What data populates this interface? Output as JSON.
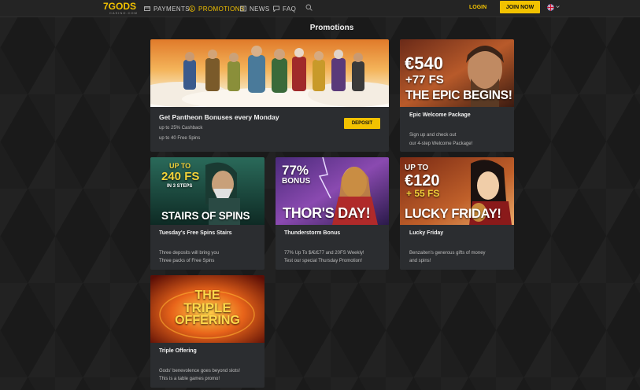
{
  "logo": {
    "main": "7GODS",
    "sub": "CASINO.COM"
  },
  "nav": [
    {
      "label": "PAYMENTS",
      "icon": "payments-icon"
    },
    {
      "label": "PROMOTIONS",
      "icon": "promotions-icon",
      "active": true
    },
    {
      "label": "NEWS",
      "icon": "news-icon"
    },
    {
      "label": "FAQ",
      "icon": "faq-icon"
    }
  ],
  "header": {
    "login": "LOGIN",
    "join": "JOIN NOW",
    "language_icon": "uk-flag-icon"
  },
  "page_title": "Promotions",
  "colors": {
    "accent": "#f2c200",
    "card_bg": "#2b2d30",
    "header_bg": "#242424"
  },
  "promos": {
    "pantheon": {
      "title": "Get Pantheon Bonuses every Monday",
      "line1": "up to 25% Cashback",
      "line2": "up to 40 Free Spins",
      "button": "DEPOSIT"
    },
    "epic": {
      "img_line1": "€540",
      "img_line2": "+77 FS",
      "img_line3": "THE EPIC BEGINS!",
      "title": "Epic Welcome Package",
      "line1": "Sign up and check out",
      "line2": "our 4-step Welcome Package!"
    },
    "stairs": {
      "img_line1": "UP TO",
      "img_line2": "240 FS",
      "img_line3": "IN 3 STEPS",
      "img_line4": "STAIRS OF SPINS",
      "title": "Tuesday's Free Spins Stairs",
      "line1": "Three deposits will bring you",
      "line2": "Three packs of Free Spins"
    },
    "thor": {
      "img_line1": "77%",
      "img_line2": "BONUS",
      "img_line3": "THOR'S DAY!",
      "title": "Thunderstorm Bonus",
      "line1": "77% Up To $/€/£77 and 20FS Weekly!",
      "line2": "Test our special Thursday Promotion!"
    },
    "friday": {
      "img_line1": "UP TO",
      "img_line2": "€120",
      "img_line3": "+ 55 FS",
      "img_line4": "LUCKY FRIDAY!",
      "title": "Lucky Friday",
      "line1": "Benzaiten's generous gifts of money",
      "line2": "and spins!"
    },
    "triple": {
      "img_line1": "THE",
      "img_line2": "TRIPLE",
      "img_line3": "OFFERING",
      "title": "Triple Offering",
      "line1": "Gods' benevolence goes beyond slots!",
      "line2": "This is a table games promo!"
    }
  }
}
